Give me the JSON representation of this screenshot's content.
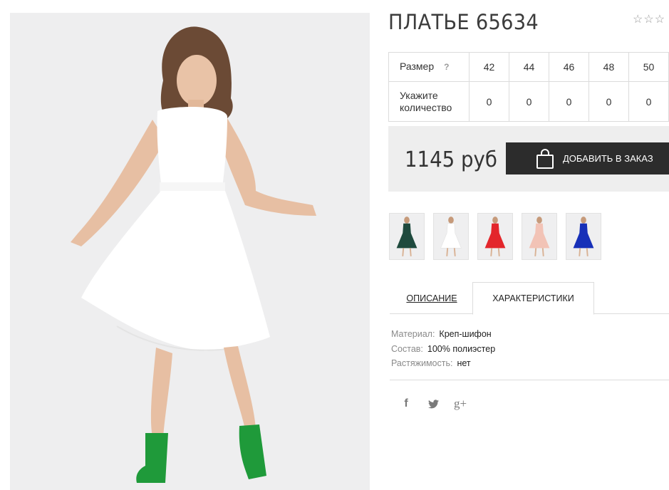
{
  "product": {
    "title": "ПЛАТЬЕ 65634",
    "rating_icons": [
      "star-outline-icon",
      "star-outline-icon",
      "star-outline-icon"
    ]
  },
  "size_table": {
    "size_label": "Размер",
    "help_glyph": "?",
    "sizes": [
      "42",
      "44",
      "46",
      "48",
      "50"
    ],
    "quantity_label_line1": "Укажите",
    "quantity_label_line2": "количество",
    "quantities": [
      "0",
      "0",
      "0",
      "0",
      "0"
    ]
  },
  "order": {
    "price": "1145 руб",
    "button_label": "ДОБАВИТЬ В ЗАКАЗ",
    "button_icon": "shopping-bag-icon",
    "button_color": "#2c2c2c"
  },
  "variants": [
    {
      "color": "#1f4a3e",
      "name": "variant-green"
    },
    {
      "color": "#ffffff",
      "name": "variant-white"
    },
    {
      "color": "#e3262b",
      "name": "variant-red"
    },
    {
      "color": "#f2c3b6",
      "name": "variant-peach"
    },
    {
      "color": "#1730b8",
      "name": "variant-blue"
    }
  ],
  "tabs": {
    "description": "ОПИСАНИЕ",
    "characteristics": "ХАРАКТЕРИСТИКИ",
    "active": "characteristics"
  },
  "specs": [
    {
      "label": "Материал:",
      "value": "Креп-шифон"
    },
    {
      "label": "Состав:",
      "value": "100% полиэстер"
    },
    {
      "label": "Растяжимость:",
      "value": "нет"
    }
  ],
  "social": {
    "facebook_glyph": "f",
    "googleplus_glyph": "g+",
    "icons": [
      "facebook-icon",
      "twitter-icon",
      "google-plus-icon"
    ]
  }
}
